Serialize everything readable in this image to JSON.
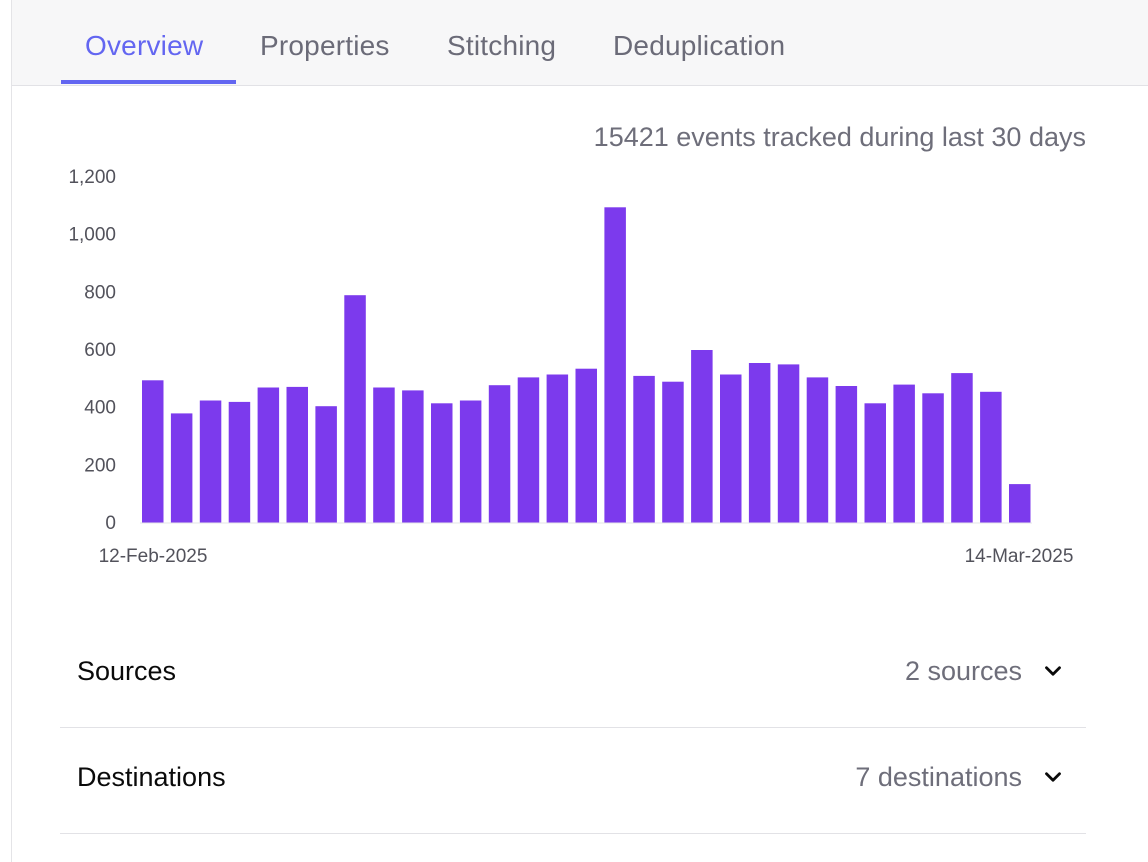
{
  "tabs": [
    {
      "label": "Overview",
      "active": true
    },
    {
      "label": "Properties",
      "active": false
    },
    {
      "label": "Stitching",
      "active": false
    },
    {
      "label": "Deduplication",
      "active": false
    }
  ],
  "summary": "15421 events tracked during last 30 days",
  "accent_color": "#6366f1",
  "bar_color": "#7c3aed",
  "chart_data": {
    "type": "bar",
    "title": "",
    "xlabel": "",
    "ylabel": "",
    "x_start_label": "12-Feb-2025",
    "x_end_label": "14-Mar-2025",
    "yticks": [
      "0",
      "200",
      "400",
      "600",
      "800",
      "1,000",
      "1,200"
    ],
    "ylim": [
      0,
      1200
    ],
    "grid": false,
    "values": [
      495,
      380,
      425,
      420,
      470,
      472,
      405,
      790,
      470,
      460,
      415,
      425,
      478,
      505,
      515,
      535,
      1095,
      510,
      490,
      600,
      515,
      555,
      550,
      505,
      475,
      415,
      480,
      450,
      520,
      455,
      135
    ]
  },
  "sections": [
    {
      "label": "Sources",
      "value": "2 sources",
      "icon": "chevron-down-icon"
    },
    {
      "label": "Destinations",
      "value": "7 destinations",
      "icon": "chevron-down-icon"
    }
  ]
}
